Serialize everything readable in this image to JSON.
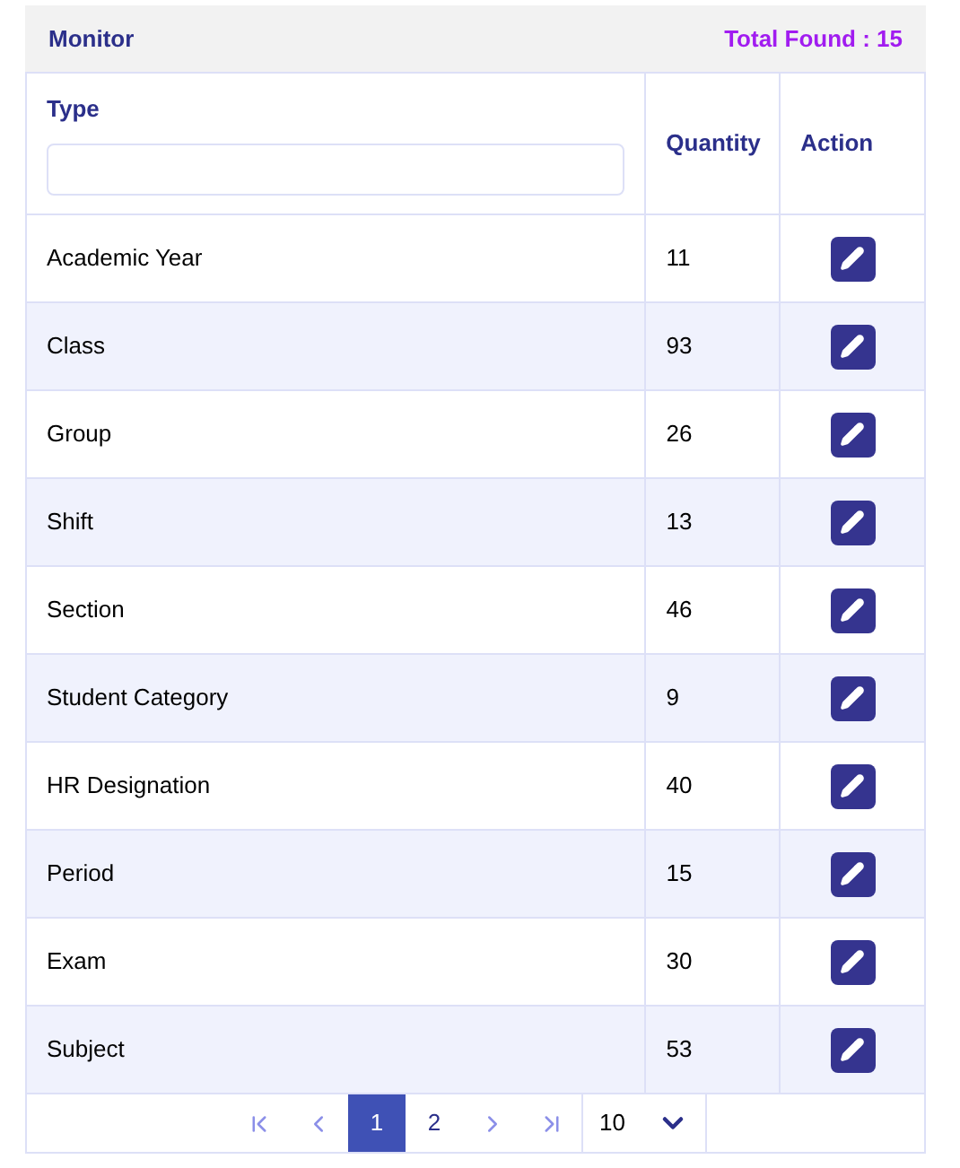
{
  "panel": {
    "title": "Monitor",
    "total": "Total Found : 15"
  },
  "table": {
    "columns": [
      {
        "label": "Type",
        "kind": "filter"
      },
      {
        "label": "Quantity",
        "kind": "plain"
      },
      {
        "label": "Action",
        "kind": "plain"
      }
    ],
    "rows": [
      {
        "type": "Academic Year",
        "quantity": "11"
      },
      {
        "type": "Class",
        "quantity": "93"
      },
      {
        "type": "Group",
        "quantity": "26"
      },
      {
        "type": "Shift",
        "quantity": "13"
      },
      {
        "type": "Section",
        "quantity": "46"
      },
      {
        "type": "Student Category",
        "quantity": "9"
      },
      {
        "type": "HR Designation",
        "quantity": "40"
      },
      {
        "type": "Period",
        "quantity": "15"
      },
      {
        "type": "Exam",
        "quantity": "30"
      },
      {
        "type": "Subject",
        "quantity": "53"
      }
    ]
  },
  "pagination": {
    "pages": [
      {
        "label": "1",
        "selected": true
      },
      {
        "label": "2",
        "selected": false
      }
    ],
    "page_size": "10"
  }
}
